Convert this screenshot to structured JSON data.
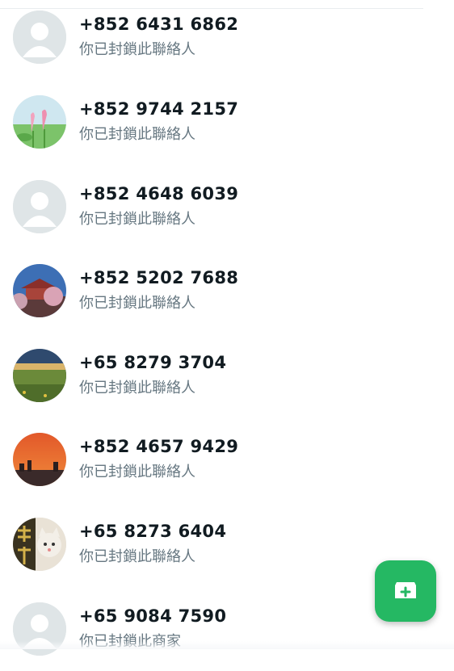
{
  "contacts": [
    {
      "phone": "+852 6431 6862",
      "status": "你已封鎖此聯絡人",
      "avatar": "default-avatar-icon"
    },
    {
      "phone": "+852 9744 2157",
      "status": "你已封鎖此聯絡人",
      "avatar": "lotus-photo"
    },
    {
      "phone": "+852 4648 6039",
      "status": "你已封鎖此聯絡人",
      "avatar": "default-avatar-icon"
    },
    {
      "phone": "+852 5202 7688",
      "status": "你已封鎖此聯絡人",
      "avatar": "temple-blossom-photo"
    },
    {
      "phone": "+65 8279 3704",
      "status": "你已封鎖此聯絡人",
      "avatar": "meadow-sky-photo"
    },
    {
      "phone": "+852 4657 9429",
      "status": "你已封鎖此聯絡人",
      "avatar": "sunset-skyline-photo"
    },
    {
      "phone": "+65 8273 6404",
      "status": "你已封鎖此聯絡人",
      "avatar": "cat-fortune-photo"
    },
    {
      "phone": "+65 9084 7590",
      "status": "你已封鎖此商家",
      "avatar": "default-avatar-icon"
    }
  ],
  "fab": {
    "icon": "add-message-icon",
    "color": "#25b863"
  },
  "colors": {
    "primary_text": "#111b21",
    "secondary_text": "#667781",
    "avatar_bg": "#dfe5e7"
  }
}
